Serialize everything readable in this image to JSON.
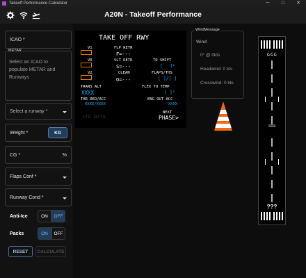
{
  "window": {
    "title": "Takeoff Performance Calculator",
    "minimize": "─",
    "maximize": "□",
    "close": "✕"
  },
  "header": {
    "title": "A20N - Takeoff Performance"
  },
  "form": {
    "icao_label": "ICAO *",
    "metar_label": "METAR",
    "metar_hint_lines": [
      "Select an ICAO to",
      "populate METAR and",
      "Runways"
    ],
    "runway_placeholder": "Select a runway *",
    "weight_label": "Weight *",
    "weight_unit": "KG",
    "cg_label": "CG *",
    "cg_unit": "%",
    "flaps_label": "Flaps Conf *",
    "runway_cond_label": "Runway Cond *",
    "anti_ice_label": "Anti-Ice",
    "anti_ice_on": "ON",
    "anti_ice_off": "OFF",
    "anti_ice_value": "OFF",
    "packs_label": "Packs",
    "packs_on": "ON",
    "packs_off": "OFF",
    "packs_value": "ON",
    "reset_label": "RESET",
    "calculate_label": "CALCULATE"
  },
  "mcdu": {
    "title": "TAKE OFF RWY",
    "v1_label": "V1",
    "vr_label": "VR",
    "v2_label": "V2",
    "flp_retr_label": "FLP RETR",
    "flp_retr_value": "F=---",
    "slt_retr_label": "SLT RETR",
    "slt_retr_value": "S=---",
    "clean_label": "CLEAN",
    "clean_value": "O=---",
    "to_shift_label": "TO SHIFT",
    "to_shift_value": "[   ]*",
    "flaps_ths_label": "FLAPS/THS",
    "flaps_ths_value": "[ ]/[ ]",
    "trans_alt_label": "TRANS ALT",
    "trans_alt_value": "XXXX",
    "flex_to_temp_label": "FLEX TO TEMP",
    "flex_to_temp_value": "[ ]°",
    "thr_red_acc_label": "THR RED/ACC",
    "thr_red_acc_value": "XXXX/XXXX",
    "eng_out_acc_label": "ENG OUT ACC",
    "eng_out_acc_value": "XXXX",
    "to_data_value": "<TO DATA",
    "next_label": "NEXT",
    "next_phase_value": "PHASE>"
  },
  "wind": {
    "legend": "WindMessage",
    "wind_label": "Wind:",
    "wind_value": "0° @ 0kts",
    "headwind": "Headwind: 0 kts",
    "crosswind": "Crosswind: 0 kts"
  },
  "runway": {
    "top_designator": "¿¿¿",
    "bottom_designator": "???",
    "mid_marker": "≡≡≡"
  },
  "colors": {
    "mcdu_green": "#00d000",
    "mcdu_cyan": "#00b7ff",
    "mcdu_amber": "#e87a00",
    "accent_blue": "#1f3d5c",
    "cone_orange": "#f26a10"
  }
}
